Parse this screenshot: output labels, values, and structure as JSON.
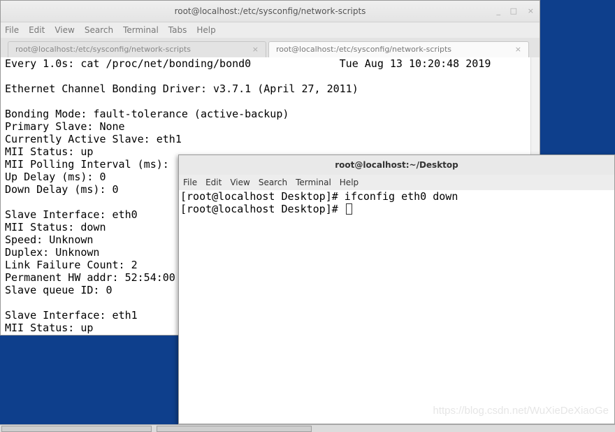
{
  "window_back": {
    "title": "root@localhost:/etc/sysconfig/network-scripts",
    "menu": [
      "File",
      "Edit",
      "View",
      "Search",
      "Terminal",
      "Tabs",
      "Help"
    ],
    "tabs": [
      {
        "label": "root@localhost:/etc/sysconfig/network-scripts"
      },
      {
        "label": "root@localhost:/etc/sysconfig/network-scripts"
      }
    ],
    "terminal_lines": [
      "Every 1.0s: cat /proc/net/bonding/bond0              Tue Aug 13 10:20:48 2019",
      "",
      "Ethernet Channel Bonding Driver: v3.7.1 (April 27, 2011)",
      "",
      "Bonding Mode: fault-tolerance (active-backup)",
      "Primary Slave: None",
      "Currently Active Slave: eth1",
      "MII Status: up",
      "MII Polling Interval (ms):",
      "Up Delay (ms): 0",
      "Down Delay (ms): 0",
      "",
      "Slave Interface: eth0",
      "MII Status: down",
      "Speed: Unknown",
      "Duplex: Unknown",
      "Link Failure Count: 2",
      "Permanent HW addr: 52:54:00",
      "Slave queue ID: 0",
      "",
      "Slave Interface: eth1",
      "MII Status: up"
    ]
  },
  "window_front": {
    "title": "root@localhost:~/Desktop",
    "menu": [
      "File",
      "Edit",
      "View",
      "Search",
      "Terminal",
      "Help"
    ],
    "terminal_lines": [
      "[root@localhost Desktop]# ifconfig eth0 down",
      "[root@localhost Desktop]# "
    ]
  },
  "watermark": "https://blog.csdn.net/WuXieDeXiaoGe"
}
